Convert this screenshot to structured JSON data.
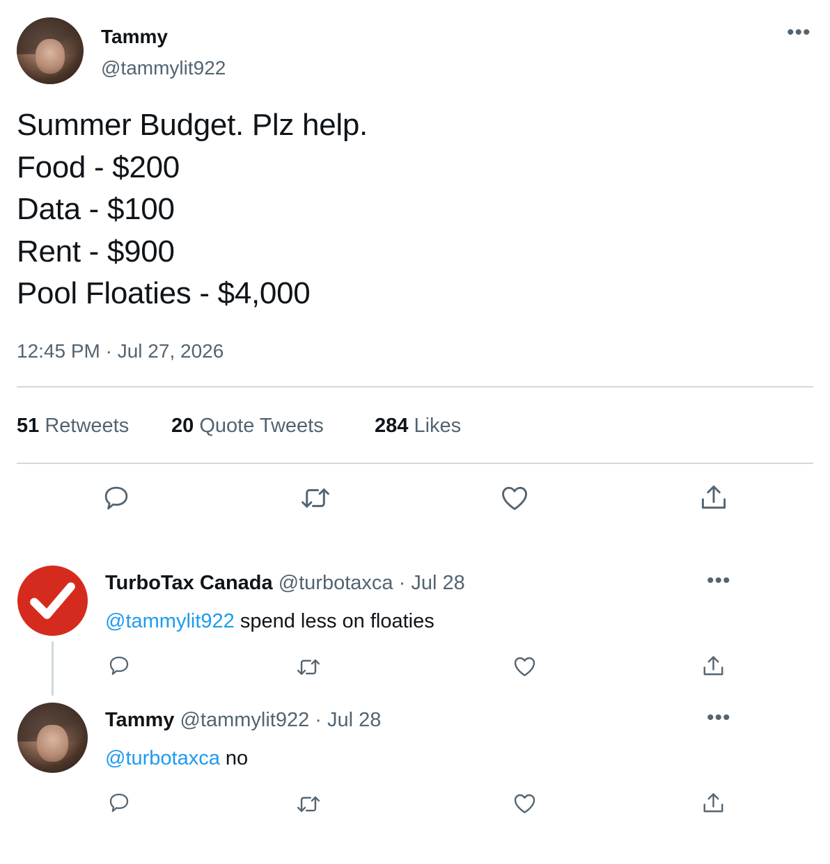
{
  "tweet": {
    "author": {
      "name": "Tammy",
      "handle": "@tammylit922"
    },
    "more_label": "•••",
    "lines": [
      "Summer Budget. Plz help.",
      "Food - $200",
      "Data - $100",
      "Rent - $900",
      "Pool Floaties - $4,000"
    ],
    "timestamp": "12:45 PM · Jul 27, 2026",
    "stats": {
      "retweets": {
        "count": "51",
        "label": "Retweets"
      },
      "quotes": {
        "count": "20",
        "label": "Quote Tweets"
      },
      "likes": {
        "count": "284",
        "label": "Likes"
      }
    },
    "actions": {
      "reply_icon": "reply-icon",
      "retweet_icon": "retweet-icon",
      "like_icon": "heart-icon",
      "share_icon": "share-icon"
    }
  },
  "replies": [
    {
      "name": "TurboTax Canada",
      "handle": "@turbotaxca",
      "date": "· Jul 28",
      "mention": "@tammylit922",
      "text": " spend less on floaties",
      "more_label": "•••"
    },
    {
      "name": "Tammy",
      "handle": "@tammylit922",
      "date": "· Jul 28",
      "mention": "@turbotaxca",
      "text": " no",
      "more_label": "•••"
    }
  ],
  "colors": {
    "accent": "#1d9bf0",
    "secondary_text": "#536471",
    "divider": "#cfd9de",
    "turbotax_red": "#d52b1e"
  }
}
